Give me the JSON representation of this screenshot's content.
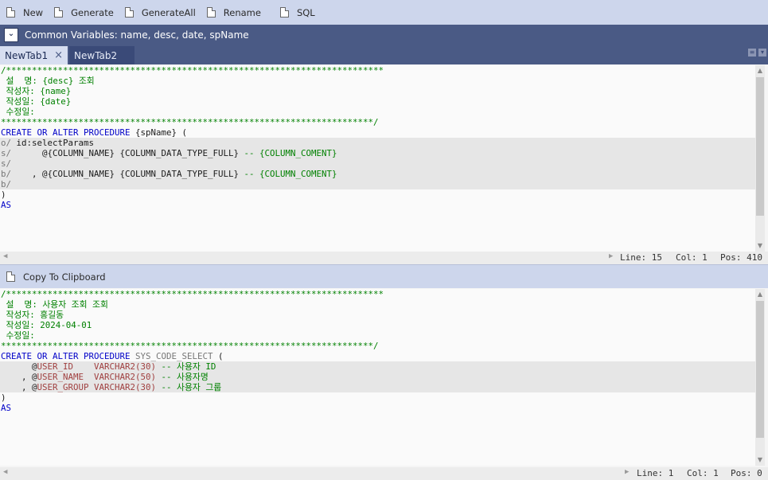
{
  "toolbar": {
    "items": [
      {
        "label": "New",
        "icon": "document-icon"
      },
      {
        "label": "Generate",
        "icon": "document-icon"
      },
      {
        "label": "GenerateAll",
        "icon": "document-icon"
      },
      {
        "label": "Rename",
        "icon": "document-icon"
      },
      {
        "label": "SQL",
        "icon": "document-icon"
      }
    ]
  },
  "variables": {
    "collapse_icon": "chevron-double-down-icon",
    "text": "Common Variables: name, desc, date, spName"
  },
  "tabs": [
    {
      "label": "NewTab1",
      "active": true,
      "close": "×"
    },
    {
      "label": "NewTab2",
      "active": false
    }
  ],
  "template_editor": {
    "lines": [
      {
        "t": "/*************************************************************************",
        "c": "cmt"
      },
      {
        "t": " 설  명: {desc} 조회",
        "c": "cmt"
      },
      {
        "t": " 작성자: {name}",
        "c": "cmt"
      },
      {
        "t": " 작성일: {date}",
        "c": "cmt"
      },
      {
        "t": " 수정일:",
        "c": "cmt"
      },
      {
        "t": "************************************************************************/",
        "c": "cmt"
      },
      {
        "parts": [
          {
            "t": "CREATE OR ALTER PROCEDURE ",
            "c": "kw"
          },
          {
            "t": "{spName} (",
            "c": "ph"
          }
        ]
      },
      {
        "parts": [
          {
            "t": "o/ ",
            "c": "dim"
          },
          {
            "t": "id:selectParams",
            "c": "ph"
          }
        ],
        "hl": true
      },
      {
        "parts": [
          {
            "t": "s/      ",
            "c": "dim"
          },
          {
            "t": "@{COLUMN_NAME} {COLUMN_DATA_TYPE_FULL} ",
            "c": "ph"
          },
          {
            "t": "-- {COLUMN_COMENT}",
            "c": "cmt"
          }
        ],
        "hl": true
      },
      {
        "parts": [
          {
            "t": "s/",
            "c": "dim"
          }
        ],
        "hl": true
      },
      {
        "parts": [
          {
            "t": "b/    ",
            "c": "dim"
          },
          {
            "t": ", @{COLUMN_NAME} {COLUMN_DATA_TYPE_FULL} ",
            "c": "ph"
          },
          {
            "t": "-- {COLUMN_COMENT}",
            "c": "cmt"
          }
        ],
        "hl": true
      },
      {
        "parts": [
          {
            "t": "b/",
            "c": "dim"
          }
        ],
        "hl": true
      },
      {
        "t": ")",
        "c": "ph"
      },
      {
        "t": "AS",
        "c": "kw"
      }
    ]
  },
  "template_status": {
    "line": "Line: 15",
    "col": "Col: 1",
    "pos": "Pos: 410"
  },
  "clipboard": {
    "label": "Copy To Clipboard",
    "icon": "document-icon"
  },
  "output_editor": {
    "lines": [
      {
        "t": "/*************************************************************************",
        "c": "cmt"
      },
      {
        "t": " 설  명: 사용자 조회 조회",
        "c": "cmt"
      },
      {
        "t": " 작성자: 홍길동",
        "c": "cmt"
      },
      {
        "t": " 작성일: 2024-04-01",
        "c": "cmt"
      },
      {
        "t": " 수정일:",
        "c": "cmt"
      },
      {
        "t": "************************************************************************/",
        "c": "cmt"
      },
      {
        "parts": [
          {
            "t": "CREATE OR ALTER PROCEDURE ",
            "c": "kw"
          },
          {
            "t": "SYS_CODE_SELECT",
            "c": "dim"
          },
          {
            "t": " (",
            "c": "ph"
          }
        ]
      },
      {
        "parts": [
          {
            "t": "      @",
            "c": "ph"
          },
          {
            "t": "USER_ID    VARCHAR2(30) ",
            "c": "var"
          },
          {
            "t": "-- 사용자 ID",
            "c": "cmt"
          }
        ],
        "hl": true
      },
      {
        "parts": [
          {
            "t": "    , @",
            "c": "ph"
          },
          {
            "t": "USER_NAME  VARCHAR2(50) ",
            "c": "var"
          },
          {
            "t": "-- 사용자명",
            "c": "cmt"
          }
        ],
        "hl": true
      },
      {
        "parts": [
          {
            "t": "    , @",
            "c": "ph"
          },
          {
            "t": "USER_GROUP VARCHAR2(30) ",
            "c": "var"
          },
          {
            "t": "-- 사용자 그룹",
            "c": "cmt"
          }
        ],
        "hl": true
      },
      {
        "t": ")",
        "c": "ph"
      },
      {
        "t": "AS",
        "c": "kw"
      }
    ]
  },
  "output_status": {
    "line": "Line: 1",
    "col": "Col: 1",
    "pos": "Pos: 0"
  }
}
